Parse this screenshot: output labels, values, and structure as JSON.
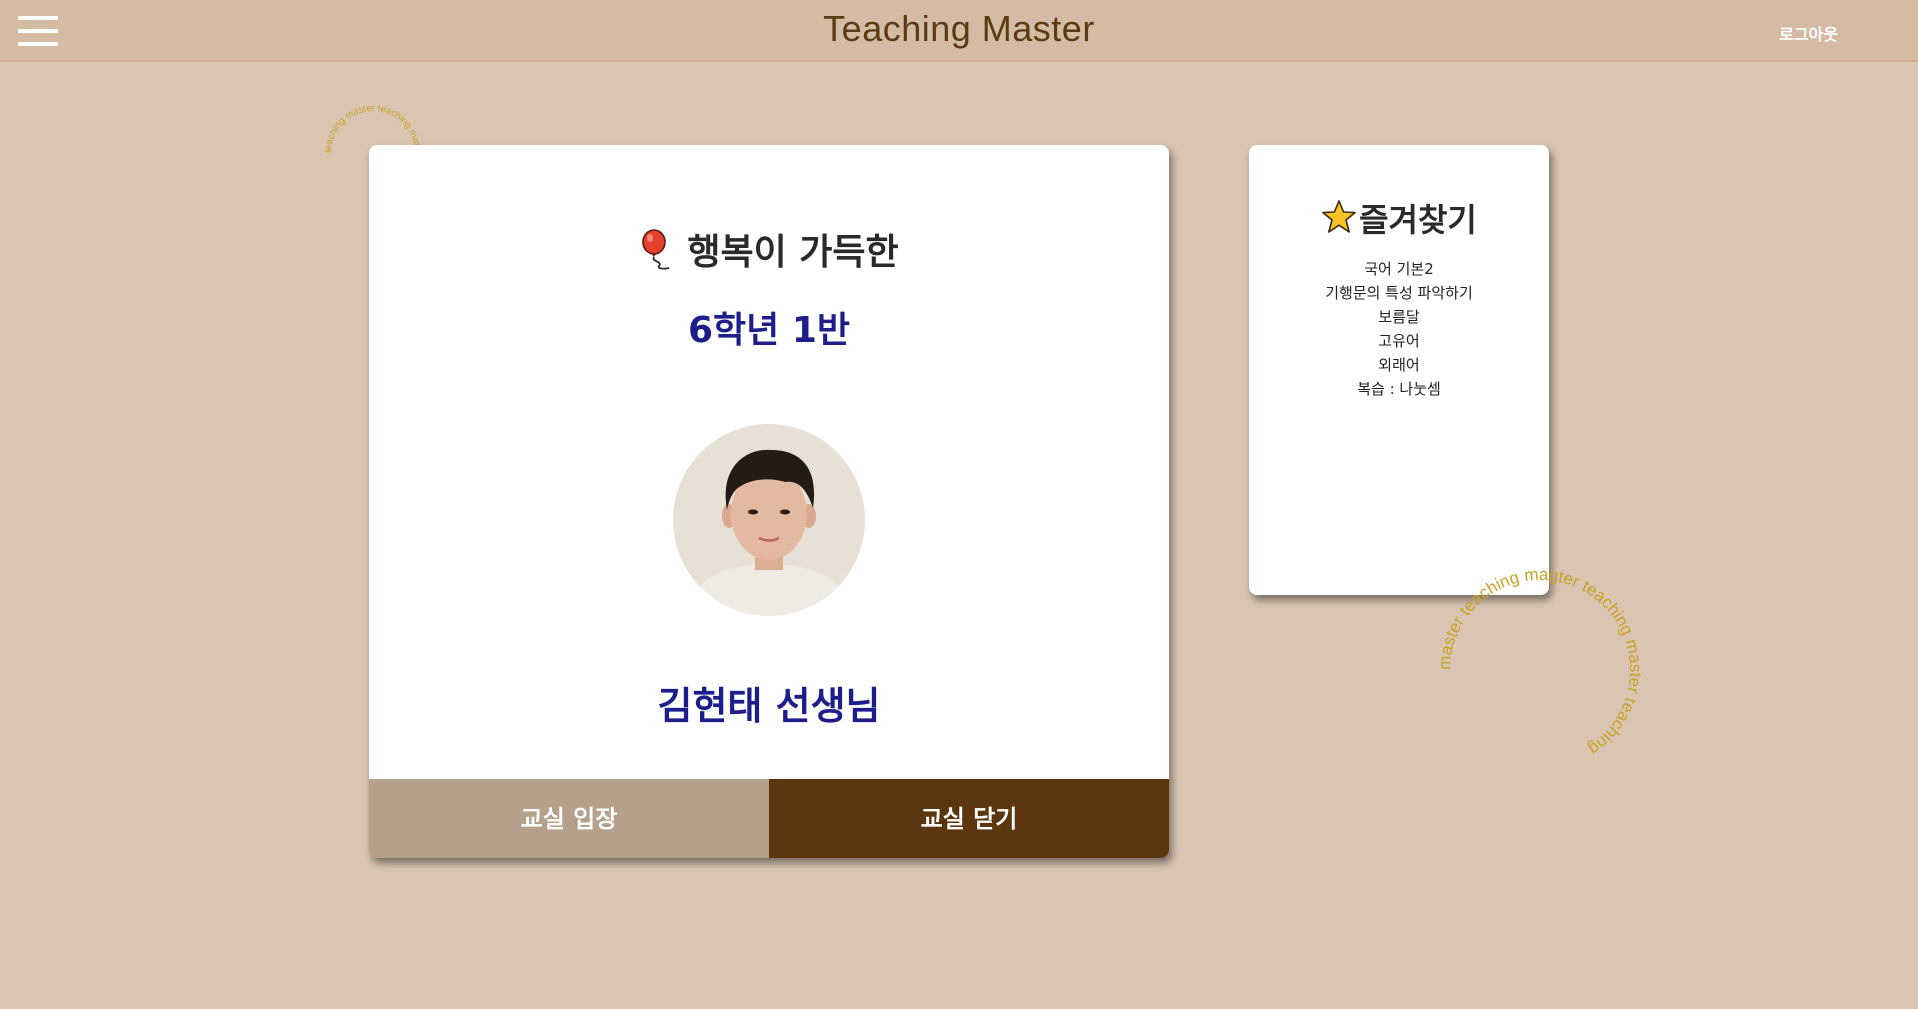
{
  "header": {
    "title": "Teaching Master",
    "logout_label": "로그아웃"
  },
  "stamps": {
    "small_text": "teaching master teaching master",
    "large_text": "master teaching magter teaching master teaching"
  },
  "classroom": {
    "motto": "행복이 가득한",
    "grade_class": "6학년 1반",
    "teacher_name": "김현태 선생님",
    "enter_label": "교실 입장",
    "close_label": "교실 닫기"
  },
  "favorites": {
    "title": "즐겨찾기",
    "items": [
      "국어 기본2",
      "기행문의 특성 파악하기",
      "보름달",
      "고유어",
      "외래어",
      "복습 : 나눗셈"
    ]
  },
  "colors": {
    "background": "#d9c5b2",
    "header": "#d4bba3",
    "title_brown": "#5b3c12",
    "navy_text": "#1d1d8c",
    "enter_button": "#b4a08b",
    "close_button": "#5a350d",
    "stamp_gold": "#c9a227"
  }
}
